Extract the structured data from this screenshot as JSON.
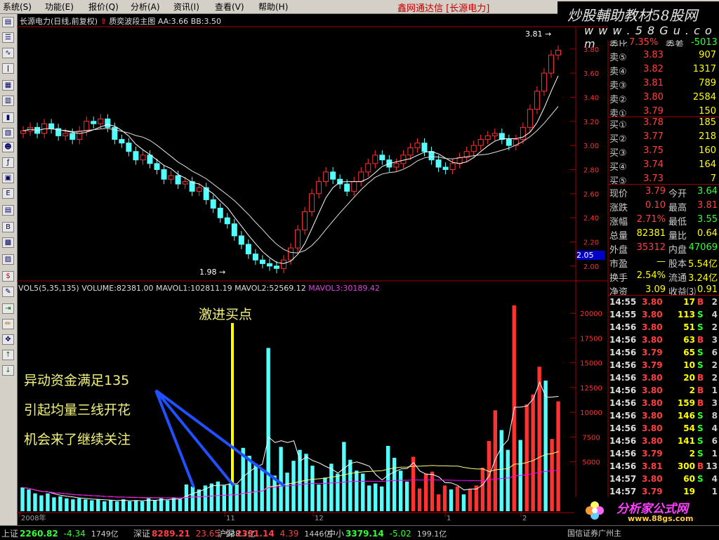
{
  "menu": [
    "系统(S)",
    "功能(E)",
    "报价(Q)",
    "分析(A)",
    "资讯(I)",
    "查看(V)",
    "帮助(H)"
  ],
  "app_title": "鑫网通达信 [长源电力]",
  "watermark_top": {
    "line1": "炒股輔助教材58股网",
    "line2": "w w w . 5 8 G u . c o m"
  },
  "chart_header": {
    "name": "长源电力(日线,前复权)",
    "indicator": "质奕波段主图",
    "aa": "AA:3.66",
    "bb": "BB:3.50"
  },
  "price_labels": {
    "high_mark": "3.81",
    "low_mark": "1.98",
    "current": "2.05"
  },
  "vol_header": {
    "vol": "VOL5(5,35,135)",
    "volume": "VOLUME:82381.00",
    "mavol1": "MAVOL1:102811.19",
    "mavol2": "MAVOL2:52569.12",
    "mavol3": "MAVOL3:30189.42"
  },
  "annotations": {
    "buy_point": "激进买点",
    "line1": "异动资金满足135",
    "line2": "引起均量三线开花",
    "line3": "机会来了继续关注"
  },
  "date_labels": [
    "2008年",
    "11",
    "12",
    "1",
    "2"
  ],
  "quote": {
    "header": {
      "l1": "委比",
      "v1": "7.35%",
      "l2": "委差",
      "v2": "-5013"
    },
    "asks": [
      {
        "label": "卖⑤",
        "price": "3.83",
        "vol": "907"
      },
      {
        "label": "卖④",
        "price": "3.82",
        "vol": "1317"
      },
      {
        "label": "卖③",
        "price": "3.81",
        "vol": "789"
      },
      {
        "label": "卖②",
        "price": "3.80",
        "vol": "2584"
      },
      {
        "label": "卖①",
        "price": "3.79",
        "vol": "150"
      }
    ],
    "bids": [
      {
        "label": "买①",
        "price": "3.78",
        "vol": "185"
      },
      {
        "label": "买②",
        "price": "3.77",
        "vol": "218"
      },
      {
        "label": "买③",
        "price": "3.75",
        "vol": "160"
      },
      {
        "label": "买④",
        "price": "3.74",
        "vol": "164"
      },
      {
        "label": "买⑤",
        "price": "3.73",
        "vol": "7"
      }
    ],
    "stats": [
      {
        "l1": "现价",
        "v1": "3.79",
        "l2": "今开",
        "v2": "3.64"
      },
      {
        "l1": "涨跌",
        "v1": "0.10",
        "l2": "最高",
        "v2": "3.81"
      },
      {
        "l1": "涨幅",
        "v1": "2.71%",
        "l2": "最低",
        "v2": "3.55"
      },
      {
        "l1": "总量",
        "v1": "82381",
        "l2": "量比",
        "v2": "0.64"
      },
      {
        "l1": "外盘",
        "v1": "35312",
        "l2": "内盘",
        "v2": "47069"
      },
      {
        "l1": "市盈",
        "v1": "—",
        "l2": "股本",
        "v2": "5.54亿"
      },
      {
        "l1": "换手",
        "v1": "2.54%",
        "l2": "流通",
        "v2": "3.24亿"
      },
      {
        "l1": "净资",
        "v1": "3.09",
        "l2": "收益⑶",
        "v2": "0.91"
      }
    ],
    "ticks": [
      {
        "t": "14:55",
        "p": "3.80",
        "v": "17",
        "f": "B",
        "n": "2"
      },
      {
        "t": "14:55",
        "p": "3.80",
        "v": "113",
        "f": "S",
        "n": "4"
      },
      {
        "t": "14:56",
        "p": "3.80",
        "v": "51",
        "f": "S",
        "n": "2"
      },
      {
        "t": "14:56",
        "p": "3.80",
        "v": "63",
        "f": "B",
        "n": "3"
      },
      {
        "t": "14:56",
        "p": "3.79",
        "v": "65",
        "f": "S",
        "n": "6"
      },
      {
        "t": "14:56",
        "p": "3.79",
        "v": "10",
        "f": "S",
        "n": "2"
      },
      {
        "t": "14:56",
        "p": "3.80",
        "v": "20",
        "f": "B",
        "n": "2"
      },
      {
        "t": "14:56",
        "p": "3.80",
        "v": "2",
        "f": "B",
        "n": "1"
      },
      {
        "t": "14:56",
        "p": "3.80",
        "v": "159",
        "f": "B",
        "n": "3"
      },
      {
        "t": "14:56",
        "p": "3.80",
        "v": "146",
        "f": "S",
        "n": "8"
      },
      {
        "t": "14:56",
        "p": "3.80",
        "v": "54",
        "f": "S",
        "n": "4"
      },
      {
        "t": "14:56",
        "p": "3.80",
        "v": "141",
        "f": "S",
        "n": "6"
      },
      {
        "t": "14:56",
        "p": "3.79",
        "v": "2",
        "f": "S",
        "n": "1"
      },
      {
        "t": "14:56",
        "p": "3.81",
        "v": "300",
        "f": "B",
        "n": "13"
      },
      {
        "t": "14:57",
        "p": "3.80",
        "v": "60",
        "f": "S",
        "n": "4"
      },
      {
        "t": "14:57",
        "p": "3.79",
        "v": "19",
        "f": "",
        "n": "1"
      }
    ]
  },
  "statusbar": [
    {
      "label": "上证",
      "val": "2260.82",
      "chg": "-4.34",
      "amt": "1749亿"
    },
    {
      "label": "深证",
      "val": "8289.21",
      "chg": "23.65",
      "amt": "938.7亿"
    },
    {
      "label": "沪深",
      "val": "2331.14",
      "chg": "4.39",
      "amt": "1446亿"
    },
    {
      "label": "中小",
      "val": "3379.14",
      "chg": "-5.02",
      "amt": "199.1亿"
    }
  ],
  "status_right": "国信证券广州主",
  "logo_bottom": {
    "text": "分析家公式网",
    "url": "www.88gs.com"
  },
  "colors": {
    "up": "#ff3232",
    "down": "#54ffff",
    "ma1": "#ffffff",
    "ma2": "#ffff00",
    "ma3": "#ff00ff",
    "annot": "#f2f27a"
  },
  "chart_data": [
    {
      "type": "line",
      "title": "长源电力(日线,前复权)",
      "ylabel": "",
      "ylim": [
        1.9,
        3.95
      ],
      "y_ticks": [
        "3.80",
        "3.60",
        "3.40",
        "3.20",
        "3.00",
        "2.80",
        "2.60",
        "2.40",
        "2.20",
        "2.00"
      ],
      "close_series": [
        3.12,
        3.15,
        3.1,
        3.18,
        3.14,
        3.08,
        3.1,
        3.05,
        3.12,
        3.2,
        3.18,
        3.22,
        3.15,
        3.05,
        3.02,
        2.95,
        2.88,
        2.92,
        2.85,
        2.8,
        2.72,
        2.75,
        2.68,
        2.7,
        2.62,
        2.65,
        2.55,
        2.48,
        2.4,
        2.35,
        2.25,
        2.18,
        2.1,
        2.05,
        2.02,
        2.0,
        1.98,
        2.05,
        2.15,
        2.3,
        2.45,
        2.6,
        2.7,
        2.78,
        2.72,
        2.68,
        2.62,
        2.7,
        2.78,
        2.85,
        2.92,
        2.88,
        2.82,
        2.85,
        2.92,
        2.98,
        3.02,
        2.95,
        2.88,
        2.82,
        2.8,
        2.85,
        2.9,
        2.95,
        3.0,
        3.05,
        3.08,
        3.1,
        3.05,
        3.0,
        3.05,
        3.15,
        3.3,
        3.45,
        3.6,
        3.75,
        3.79
      ]
    },
    {
      "type": "bar",
      "title": "VOL5(5,35,135)",
      "ylim": [
        0,
        22000
      ],
      "y_ticks": [
        "20000",
        "17500",
        "15000",
        "12500",
        "10000",
        "7500",
        "5000"
      ],
      "values": [
        2400,
        2200,
        1800,
        1600,
        1800,
        1400,
        1500,
        1300,
        1200,
        1300,
        1200,
        1100,
        1200,
        1000,
        1100,
        1000,
        1200,
        1000,
        1100,
        1000,
        1300,
        1100,
        1300,
        1100,
        1400,
        1200,
        2700,
        2500,
        2200,
        2600,
        2800,
        3000,
        2600,
        2800,
        2700,
        6400,
        5600,
        4800,
        4200,
        16500,
        3600,
        6500,
        3900,
        5100,
        6200,
        5800,
        4600,
        2700,
        3400,
        4800,
        3800,
        7000,
        5200,
        4100,
        3800,
        2600,
        2800,
        2500,
        6600,
        5400,
        4100,
        3000,
        5500,
        2300,
        3800,
        4000,
        1700,
        2600,
        2200,
        2500,
        1700,
        2200,
        2600,
        4400,
        7100,
        10200,
        8200,
        6200,
        20800,
        7200,
        10800,
        11800,
        14600,
        13200,
        7300,
        11100
      ]
    }
  ]
}
